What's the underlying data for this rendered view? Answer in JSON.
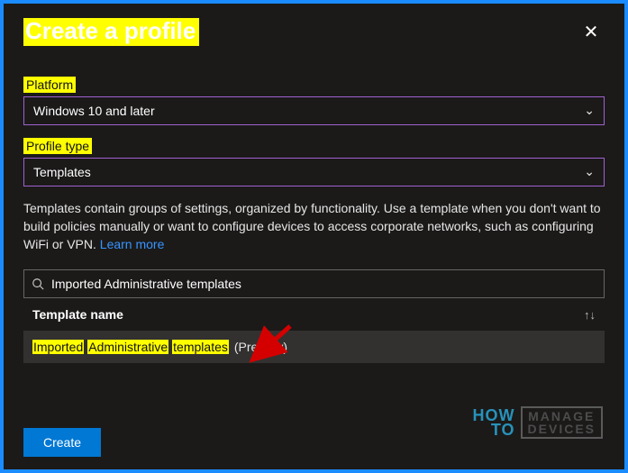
{
  "header": {
    "title": "Create a profile"
  },
  "fields": {
    "platform_label": "Platform",
    "platform_value": "Windows 10 and later",
    "profile_type_label": "Profile type",
    "profile_type_value": "Templates"
  },
  "description": {
    "text": "Templates contain groups of settings, organized by functionality. Use a template when you don't want to build policies manually or want to configure devices to access corporate networks, such as configuring WiFi or VPN. ",
    "link": "Learn more"
  },
  "search": {
    "value": "Imported Administrative templates"
  },
  "table": {
    "header": "Template name",
    "row_words": [
      "Imported",
      "Administrative",
      "templates"
    ],
    "row_suffix": "(Preview)"
  },
  "buttons": {
    "create": "Create"
  },
  "watermark": {
    "how": "HOW",
    "to": "TO",
    "manage": "MANAGE",
    "devices": "DEVICES"
  }
}
